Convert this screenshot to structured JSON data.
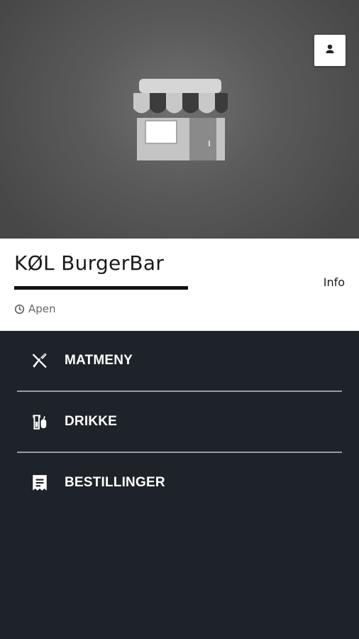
{
  "header": {
    "account_icon": "person-icon",
    "store_icon": "storefront-icon"
  },
  "store": {
    "name": "KØL BurgerBar",
    "status": "Apen",
    "status_icon": "clock-icon",
    "info_label": "Info"
  },
  "menu": {
    "items": [
      {
        "label": "MATMENY",
        "icon": "fork-knife-icon"
      },
      {
        "label": "DRIKKE",
        "icon": "drink-icon"
      },
      {
        "label": "BESTILLINGER",
        "icon": "receipt-icon"
      }
    ]
  },
  "colors": {
    "hero_bg": "#5a5a5a",
    "menu_bg": "#1e2329",
    "text_light": "#ffffff"
  }
}
